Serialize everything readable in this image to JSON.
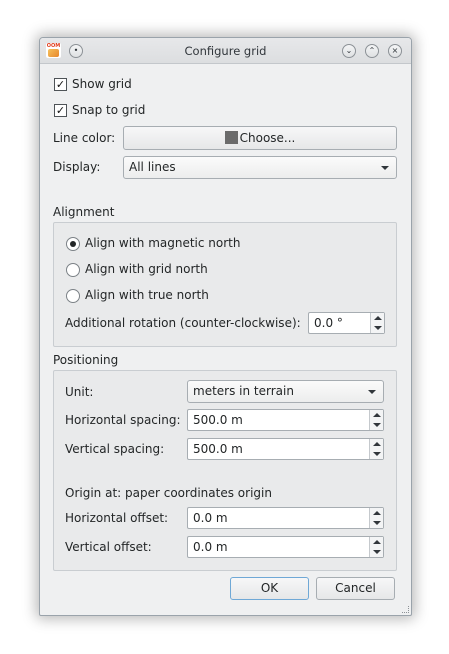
{
  "window": {
    "title": "Configure grid",
    "app_icon_text": "OOM"
  },
  "general": {
    "show_grid_label": "Show grid",
    "show_grid_checked": true,
    "snap_label": "Snap to grid",
    "snap_checked": true,
    "line_color_label": "Line color:",
    "line_color_button": "Choose...",
    "line_color_value": "#6b6b6b",
    "display_label": "Display:",
    "display_value": "All lines"
  },
  "alignment": {
    "title": "Alignment",
    "options": [
      {
        "label": "Align with magnetic north",
        "selected": true
      },
      {
        "label": "Align with grid north",
        "selected": false
      },
      {
        "label": "Align with true north",
        "selected": false
      }
    ],
    "rotation_label": "Additional rotation (counter-clockwise):",
    "rotation_value": "0.0 °"
  },
  "positioning": {
    "title": "Positioning",
    "unit_label": "Unit:",
    "unit_value": "meters in terrain",
    "h_spacing_label": "Horizontal spacing:",
    "h_spacing_value": "500.0 m",
    "v_spacing_label": "Vertical spacing:",
    "v_spacing_value": "500.0 m",
    "origin_label": "Origin at: paper coordinates origin",
    "h_offset_label": "Horizontal offset:",
    "h_offset_value": "0.0 m",
    "v_offset_label": "Vertical offset:",
    "v_offset_value": "0.0 m"
  },
  "buttons": {
    "ok": "OK",
    "cancel": "Cancel"
  }
}
